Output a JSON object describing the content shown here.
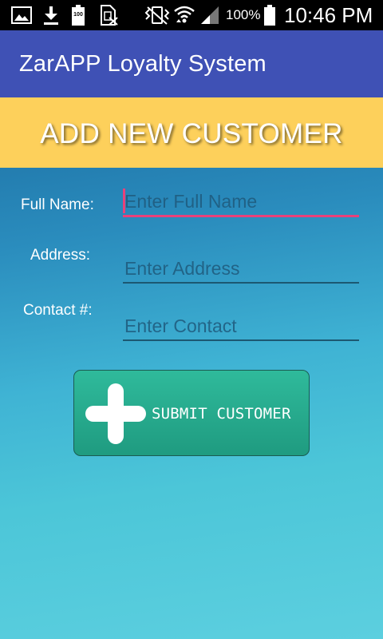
{
  "status_bar": {
    "battery_percent": "100%",
    "time": "10:46 PM",
    "small_battery_label": "100",
    "icons": [
      "image-icon",
      "download-icon",
      "battery-saver-icon",
      "sim-off-icon",
      "vibrate-icon",
      "wifi-icon",
      "signal-icon",
      "battery-icon"
    ]
  },
  "app_bar": {
    "title": "ZarAPP Loyalty System"
  },
  "header": {
    "title": "ADD NEW CUSTOMER"
  },
  "form": {
    "full_name": {
      "label": "Full Name:",
      "value": "",
      "placeholder": "Enter Full Name"
    },
    "address": {
      "label": "Address:",
      "value": "",
      "placeholder": "Enter Address"
    },
    "contact": {
      "label": "Contact #:",
      "value": "",
      "placeholder": "Enter Contact"
    }
  },
  "submit_button": {
    "label": "SUBMIT CUSTOMER",
    "icon": "plus-icon"
  },
  "colors": {
    "app_bar": "#3f51b5",
    "header_banner": "#fdd05b",
    "accent": "#e9417a",
    "button": "#26a98c"
  }
}
